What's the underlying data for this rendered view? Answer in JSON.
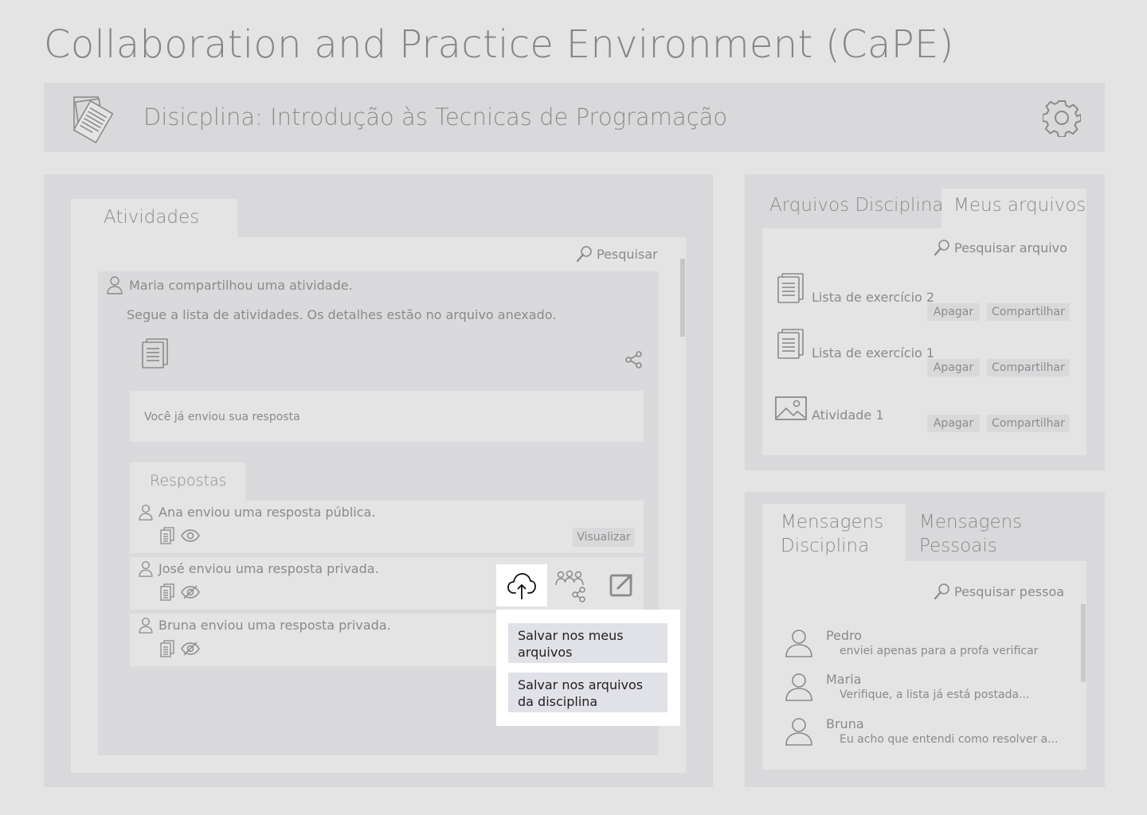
{
  "app": {
    "title": "Collaboration and Practice Environment (CaPE)"
  },
  "course": {
    "title": "Disicplina: Introdução às Tecnicas de Programação"
  },
  "activities": {
    "tab_label": "Atividades",
    "search_label": "Pesquisar",
    "post": {
      "author_line": "Maria compartilhou uma atividade.",
      "text": "Segue a lista de atividades. Os detalhes estão no arquivo anexado.",
      "status": "Você já enviou sua resposta"
    },
    "responses": {
      "tab_label": "Respostas",
      "items": [
        {
          "text": "Ana enviou uma resposta pública.",
          "visibility": "public"
        },
        {
          "text": "José enviou uma resposta privada.",
          "visibility": "private"
        },
        {
          "text": "Bruna enviou uma resposta privada.",
          "visibility": "private"
        }
      ],
      "view_button": "Visualizar"
    },
    "save_menu": {
      "items": [
        "Salvar nos meus arquivos",
        "Salvar nos arquivos da disciplina"
      ]
    }
  },
  "files": {
    "tabs": [
      "Arquivos Disciplina",
      "Meus arquivos"
    ],
    "active_tab": "Meus arquivos",
    "search_label": "Pesquisar arquivo",
    "items": [
      {
        "name": "Lista de exercício 2",
        "icon": "document-icon"
      },
      {
        "name": "Lista de exercício 1",
        "icon": "document-icon"
      },
      {
        "name": "Atividade 1",
        "icon": "image-icon"
      }
    ],
    "delete_label": "Apagar",
    "share_label": "Compartilhar"
  },
  "messages": {
    "tabs": [
      "Mensagens Disciplina",
      "Mensagens Pessoais"
    ],
    "tab1_lines": [
      "Mensagens",
      "Disciplina"
    ],
    "tab2_lines": [
      "Mensagens",
      "Pessoais"
    ],
    "active_tab": "Mensagens Disciplina",
    "search_label": "Pesquisar pessoa",
    "items": [
      {
        "name": "Pedro",
        "preview": "enviei apenas para a profa verificar"
      },
      {
        "name": "Maria",
        "preview": "Verifique, a lista já está postada..."
      },
      {
        "name": "Bruna",
        "preview": "Eu acho que entendi  como resolver a..."
      }
    ]
  },
  "colors": {
    "background": "#e4e4e5",
    "panel": "#d9d9db",
    "text": "#8a8a8a",
    "menu_item": "#e1e1e8"
  }
}
